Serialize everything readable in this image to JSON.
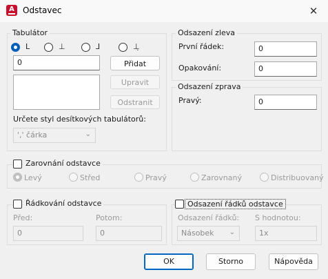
{
  "window": {
    "title": "Odstavec",
    "close_symbol": "✕",
    "app_icon_letter": "A"
  },
  "tabs_group": {
    "label": "Tabulátor",
    "tab_types": [
      {
        "icon": "tab-left-icon",
        "glyph": "L",
        "selected": true
      },
      {
        "icon": "tab-center-icon",
        "glyph": "⊥",
        "selected": false
      },
      {
        "icon": "tab-right-icon",
        "glyph": "⅃",
        "selected": false
      },
      {
        "icon": "tab-decimal-icon",
        "glyph": "⊥̣",
        "selected": false
      }
    ],
    "position_value": "0",
    "add_label": "Přidat",
    "modify_label": "Upravit",
    "remove_label": "Odstranit",
    "decimal_style_label": "Určete styl desítkových tabulátorů:",
    "decimal_style_value": "',' čárka"
  },
  "left_indent": {
    "label": "Odsazení zleva",
    "first_line_label": "První řádek:",
    "first_line_value": "0",
    "hanging_label": "Opakování:",
    "hanging_value": "0"
  },
  "right_indent": {
    "label": "Odsazení zprava",
    "right_label": "Pravý:",
    "right_value": "0"
  },
  "alignment": {
    "label": "Zarovnání odstavce",
    "options": [
      "Levý",
      "Střed",
      "Pravý",
      "Zarovnaný",
      "Distribuovaný"
    ],
    "selected_index": 0
  },
  "spacing": {
    "label": "Řádkování odstavce",
    "before_label": "Před:",
    "before_value": "0",
    "after_label": "Potom:",
    "after_value": "0"
  },
  "line_spacing": {
    "label": "Odsazení řádků odstavce",
    "type_label": "Odsazení řádků:",
    "type_value": "Násobek",
    "at_label": "S hodnotou:",
    "at_value": "1x"
  },
  "footer": {
    "ok_label": "OK",
    "cancel_label": "Storno",
    "help_label": "Nápověda"
  },
  "colors": {
    "accent": "#005fb8",
    "app_icon": "#c8102e"
  }
}
